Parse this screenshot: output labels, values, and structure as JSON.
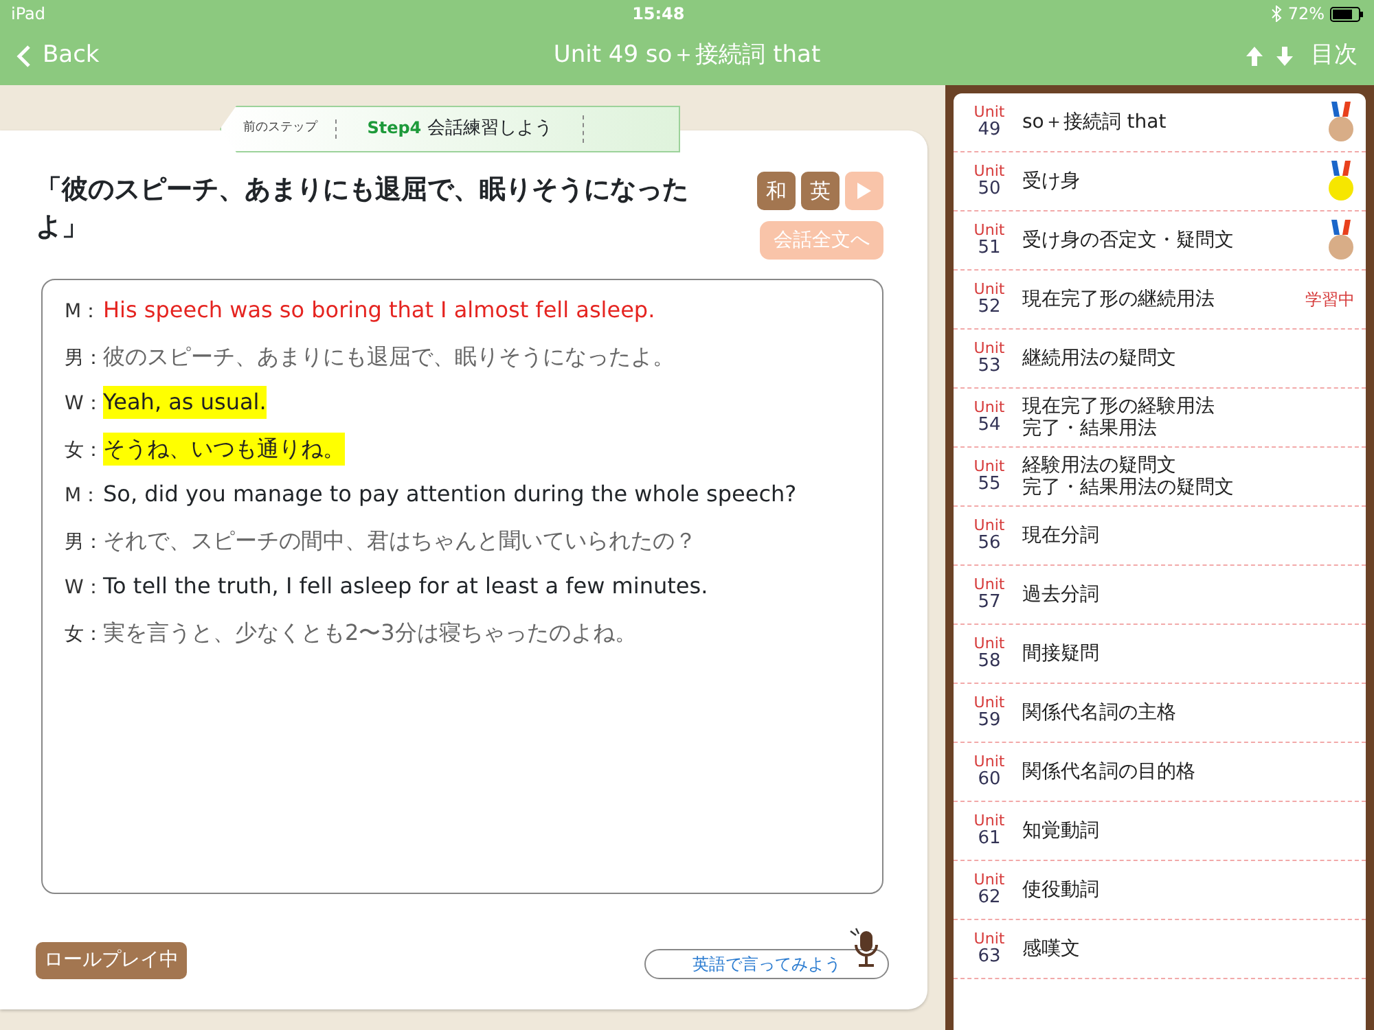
{
  "status_bar": {
    "device": "iPad",
    "time": "15:48",
    "battery": "72%"
  },
  "nav": {
    "back": "Back",
    "title": "Unit 49  so＋接続詞 that",
    "toc": "目次"
  },
  "step_tab": {
    "prev": "前のステップ",
    "step": "Step4",
    "label": "会話練習しよう"
  },
  "question": "「彼のスピーチ、あまりにも退屈で、眠りそうになったよ」",
  "buttons": {
    "japanese": "和",
    "english": "英",
    "full_dialog": "会話全文へ"
  },
  "dialog": [
    {
      "speaker": "M：",
      "text": "His speech was so boring that I almost fell asleep.",
      "kind": "en",
      "current": true,
      "highlighted": false
    },
    {
      "speaker": "男：",
      "text": "彼のスピーチ、あまりにも退屈で、眠りそうになったよ。",
      "kind": "ja",
      "current": false,
      "highlighted": false
    },
    {
      "speaker": "W：",
      "text": "Yeah, as usual.",
      "kind": "en",
      "current": false,
      "highlighted": true
    },
    {
      "speaker": "女：",
      "text": "そうね、いつも通りね。",
      "kind": "ja",
      "current": false,
      "highlighted": true
    },
    {
      "speaker": "M：",
      "text": "So, did you manage to pay attention during the whole speech?",
      "kind": "en",
      "current": false,
      "highlighted": false
    },
    {
      "speaker": "男：",
      "text": "それで、スピーチの間中、君はちゃんと聞いていられたの？",
      "kind": "ja",
      "current": false,
      "highlighted": false
    },
    {
      "speaker": "W：",
      "text": "To tell the truth, I fell asleep for at least a few minutes.",
      "kind": "en",
      "current": false,
      "highlighted": false
    },
    {
      "speaker": "女：",
      "text": "実を言うと、少なくとも2〜3分は寝ちゃったのよね。",
      "kind": "ja",
      "current": false,
      "highlighted": false
    }
  ],
  "roleplay_button": "ロールプレイ中",
  "speak_bubble": "英語で言ってみよう",
  "units": [
    {
      "label": "Unit",
      "number": "49",
      "title": [
        "so＋接続詞 that"
      ],
      "color": "#d8ad87"
    },
    {
      "label": "Unit",
      "number": "50",
      "title": [
        "受け身"
      ],
      "color": "#f6e600"
    },
    {
      "label": "Unit",
      "number": "51",
      "title": [
        "受け身の否定文・疑問文"
      ],
      "color": "#d8ad87"
    },
    {
      "label": "Unit",
      "number": "52",
      "title": [
        "現在完了形の継続用法"
      ],
      "status": "学習中"
    },
    {
      "label": "Unit",
      "number": "53",
      "title": [
        "継続用法の疑問文"
      ]
    },
    {
      "label": "Unit",
      "number": "54",
      "title": [
        "現在完了形の経験用法",
        "完了・結果用法"
      ]
    },
    {
      "label": "Unit",
      "number": "55",
      "title": [
        "経験用法の疑問文",
        "完了・結果用法の疑問文"
      ]
    },
    {
      "label": "Unit",
      "number": "56",
      "title": [
        "現在分詞"
      ]
    },
    {
      "label": "Unit",
      "number": "57",
      "title": [
        "過去分詞"
      ]
    },
    {
      "label": "Unit",
      "number": "58",
      "title": [
        "間接疑問"
      ]
    },
    {
      "label": "Unit",
      "number": "59",
      "title": [
        "関係代名詞の主格"
      ]
    },
    {
      "label": "Unit",
      "number": "60",
      "title": [
        "関係代名詞の目的格"
      ]
    },
    {
      "label": "Unit",
      "number": "61",
      "title": [
        "知覚動詞"
      ]
    },
    {
      "label": "Unit",
      "number": "62",
      "title": [
        "使役動詞"
      ]
    },
    {
      "label": "Unit",
      "number": "63",
      "title": [
        "感嘆文"
      ]
    }
  ]
}
